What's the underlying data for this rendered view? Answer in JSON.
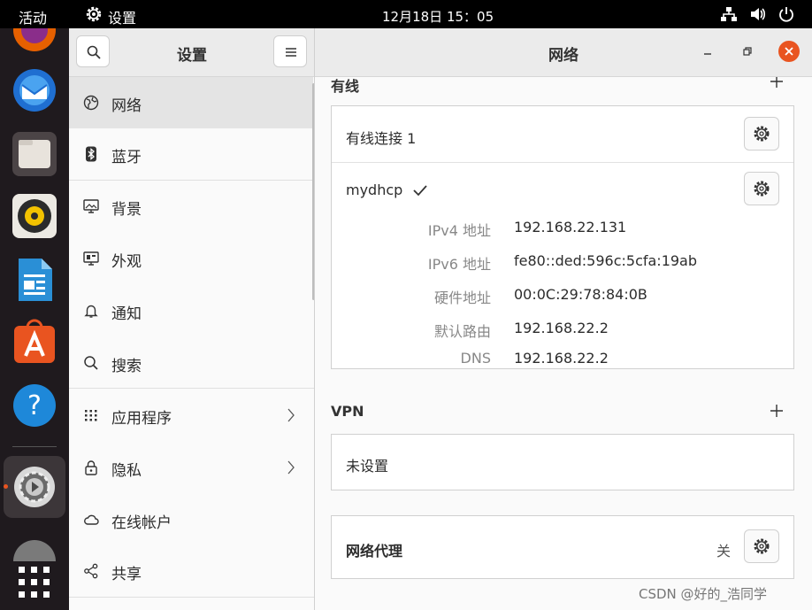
{
  "topbar": {
    "activities": "活动",
    "app_name": "设置",
    "clock": "12月18日  15：05"
  },
  "settings": {
    "title": "设置",
    "nav": [
      {
        "label": "网络",
        "icon": "network-globe-icon"
      },
      {
        "label": "蓝牙",
        "icon": "bluetooth-icon"
      },
      {
        "label": "背景",
        "icon": "background-monitor-icon"
      },
      {
        "label": "外观",
        "icon": "appearance-icon"
      },
      {
        "label": "通知",
        "icon": "bell-icon"
      },
      {
        "label": "搜索",
        "icon": "search-icon"
      },
      {
        "label": "应用程序",
        "icon": "grid-icon"
      },
      {
        "label": "隐私",
        "icon": "lock-icon"
      },
      {
        "label": "在线帐户",
        "icon": "cloud-icon"
      },
      {
        "label": "共享",
        "icon": "share-icon"
      }
    ]
  },
  "network": {
    "title": "网络",
    "wired": {
      "title": "有线",
      "connection_name": "有线连接 1",
      "profile_name": "mydhcp",
      "details": [
        {
          "key": "IPv4 地址",
          "value": "192.168.22.131"
        },
        {
          "key": "IPv6 地址",
          "value": "fe80::ded:596c:5cfa:19ab"
        },
        {
          "key": "硬件地址",
          "value": "00:0C:29:78:84:0B"
        },
        {
          "key": "默认路由",
          "value": "192.168.22.2"
        },
        {
          "key": "DNS",
          "value": "192.168.22.2"
        }
      ]
    },
    "vpn": {
      "title": "VPN",
      "empty_text": "未设置"
    },
    "proxy": {
      "title": "网络代理",
      "status": "关"
    }
  },
  "colors": {
    "accent": "#e95420",
    "dock_bg": "#1f1a1e",
    "topbar_bg": "#000000"
  },
  "watermark": "CSDN @好的_浩同学"
}
